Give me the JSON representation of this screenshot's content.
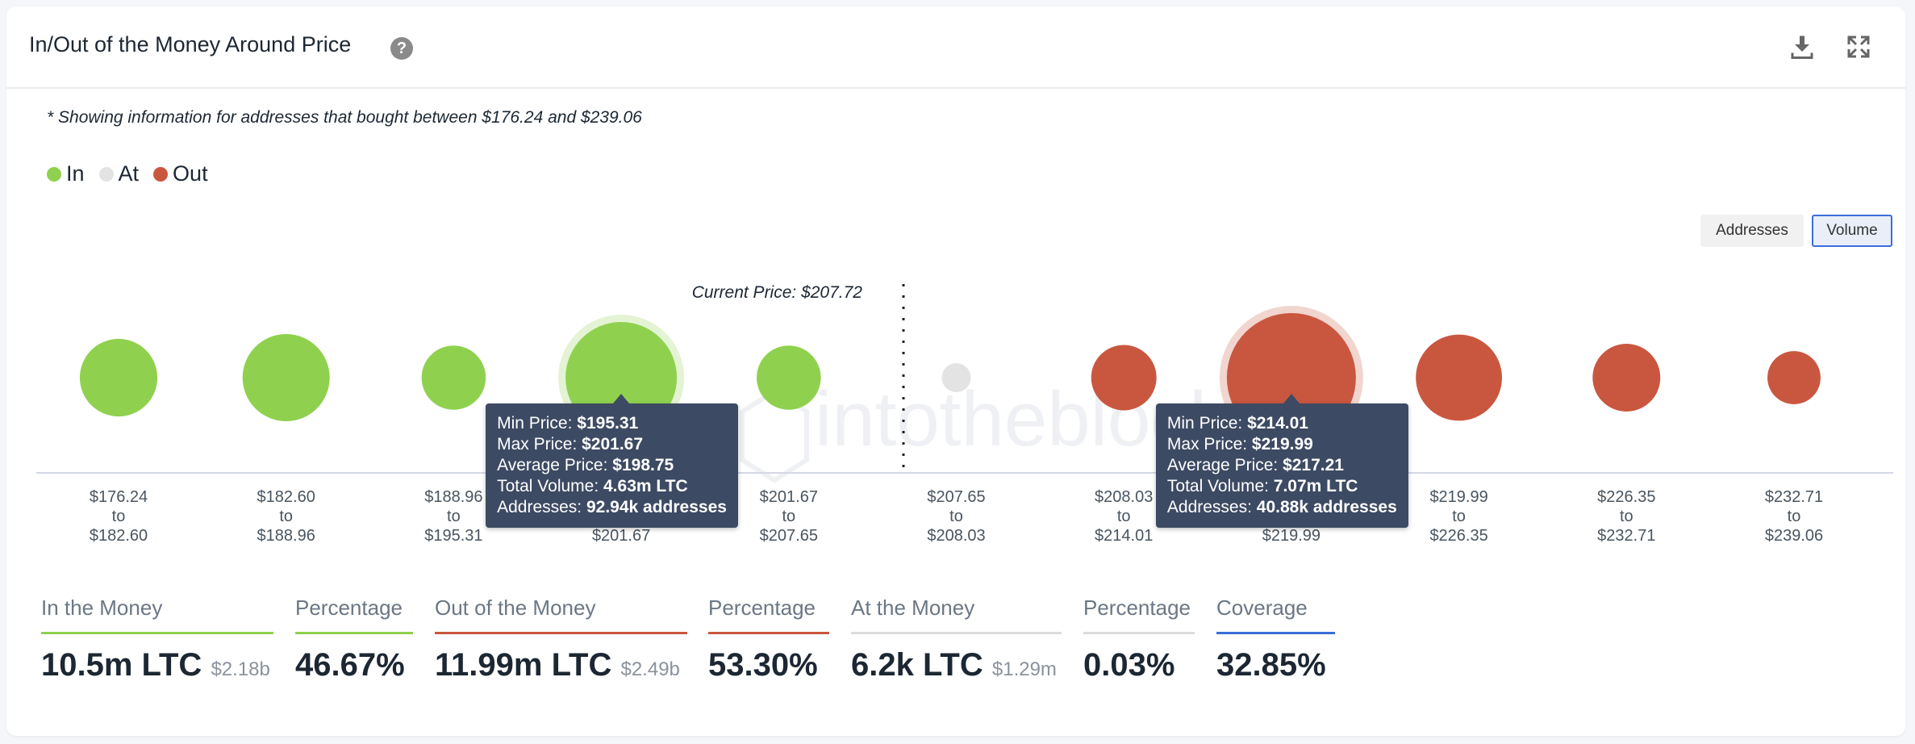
{
  "header": {
    "title": "In/Out of the Money Around Price",
    "help_icon": "question-circle-icon",
    "download_icon": "download-icon",
    "expand_icon": "expand-icon"
  },
  "note": "* Showing information for addresses that bought between $176.24 and $239.06",
  "legend": [
    {
      "label": "In",
      "color": "#8fd14f"
    },
    {
      "label": "At",
      "color": "#e3e3e3"
    },
    {
      "label": "Out",
      "color": "#c9573f"
    }
  ],
  "toggle": {
    "addresses": "Addresses",
    "volume": "Volume",
    "selected": "Volume"
  },
  "watermark": "intotheblock",
  "chart_data": {
    "type": "bubble",
    "current_price_label": "Current Price: $207.72",
    "current_price": 207.72,
    "categories": [
      {
        "from": "$176.24",
        "to_word": "to",
        "to": "$182.60",
        "status": "In",
        "volume_m": 1.65
      },
      {
        "from": "$182.60",
        "to_word": "to",
        "to": "$188.96",
        "status": "In",
        "volume_m": 2.3
      },
      {
        "from": "$188.96",
        "to_word": "to",
        "to": "$195.31",
        "status": "In",
        "volume_m": 0.96
      },
      {
        "from": "$195.31",
        "to_word": "to",
        "to": "$201.67",
        "status": "In",
        "volume_m": 4.63,
        "highlight": true
      },
      {
        "from": "$201.67",
        "to_word": "to",
        "to": "$207.65",
        "status": "In",
        "volume_m": 0.96
      },
      {
        "from": "$207.65",
        "to_word": "to",
        "to": "$208.03",
        "status": "At",
        "volume_m": 0.0062
      },
      {
        "from": "$208.03",
        "to_word": "to",
        "to": "$214.01",
        "status": "Out",
        "volume_m": 1.01
      },
      {
        "from": "$214.01",
        "to_word": "to",
        "to": "$219.99",
        "status": "Out",
        "volume_m": 7.07,
        "highlight": true
      },
      {
        "from": "$219.99",
        "to_word": "to",
        "to": "$226.35",
        "status": "Out",
        "volume_m": 2.23
      },
      {
        "from": "$226.35",
        "to_word": "to",
        "to": "$232.71",
        "status": "Out",
        "volume_m": 1.12
      },
      {
        "from": "$232.71",
        "to_word": "to",
        "to": "$239.06",
        "status": "Out",
        "volume_m": 0.56
      }
    ],
    "tooltips": [
      {
        "bubble": 3,
        "lines": [
          {
            "k": "Min Price: ",
            "v": "$195.31"
          },
          {
            "k": "Max Price: ",
            "v": "$201.67"
          },
          {
            "k": "Average Price: ",
            "v": "$198.75"
          },
          {
            "k": "Total Volume: ",
            "v": "4.63m LTC"
          },
          {
            "k": "Addresses: ",
            "v": "92.94k addresses"
          }
        ]
      },
      {
        "bubble": 7,
        "lines": [
          {
            "k": "Min Price: ",
            "v": "$214.01"
          },
          {
            "k": "Max Price: ",
            "v": "$219.99"
          },
          {
            "k": "Average Price: ",
            "v": "$217.21"
          },
          {
            "k": "Total Volume: ",
            "v": "7.07m LTC"
          },
          {
            "k": "Addresses: ",
            "v": "40.88k addresses"
          }
        ]
      }
    ]
  },
  "stats": [
    {
      "label": "In the Money",
      "value": "10.5m LTC",
      "sub": "$2.18b",
      "color": "#8fd14f"
    },
    {
      "label": "Percentage",
      "value": "46.67%",
      "sub": "",
      "color": "#8fd14f"
    },
    {
      "label": "Out of the Money",
      "value": "11.99m LTC",
      "sub": "$2.49b",
      "color": "#c9573f"
    },
    {
      "label": "Percentage",
      "value": "53.30%",
      "sub": "",
      "color": "#c9573f"
    },
    {
      "label": "At the Money",
      "value": "6.2k LTC",
      "sub": "$1.29m",
      "color": "#dcdcdc"
    },
    {
      "label": "Percentage",
      "value": "0.03%",
      "sub": "",
      "color": "#dcdcdc"
    },
    {
      "label": "Coverage",
      "value": "32.85%",
      "sub": "",
      "color": "#3b6fd8"
    }
  ]
}
